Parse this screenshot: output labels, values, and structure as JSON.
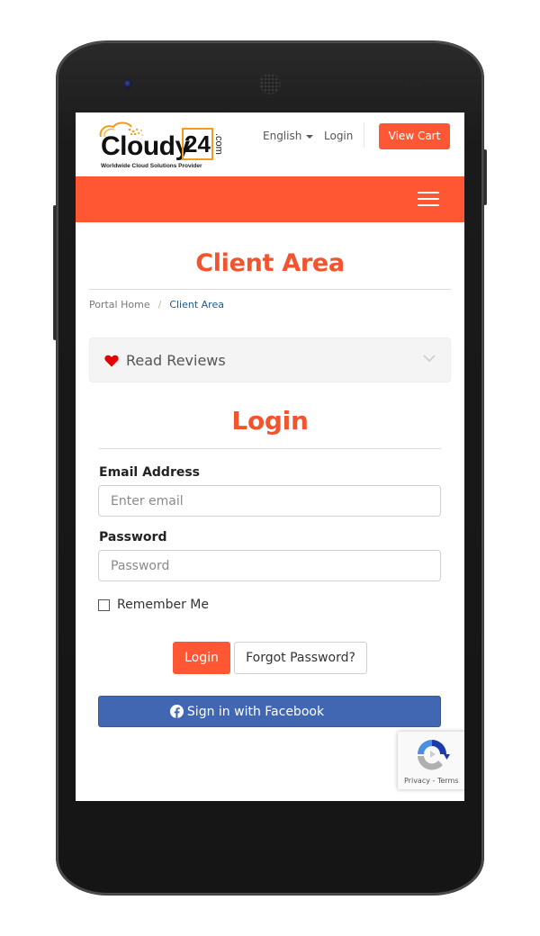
{
  "header": {
    "logo": {
      "brand": "Cloudy",
      "number": "24",
      "tld": ".com",
      "tagline": "Worldwide Cloud Solutions Provider"
    },
    "language": "English",
    "login_link": "Login",
    "view_cart_label": "View Cart"
  },
  "page": {
    "title": "Client Area",
    "breadcrumb": [
      {
        "label": "Portal Home"
      },
      {
        "label": "Client Area"
      }
    ],
    "breadcrumb_separator": "/"
  },
  "reviews": {
    "label": "Read Reviews"
  },
  "login_form": {
    "title": "Login",
    "email_label": "Email Address",
    "email_placeholder": "Enter email",
    "email_value": "",
    "password_label": "Password",
    "password_placeholder": "Password",
    "password_value": "",
    "remember_label": "Remember Me",
    "remember_checked": false,
    "login_button": "Login",
    "forgot_button": "Forgot Password?",
    "facebook_button": "Sign in with Facebook"
  },
  "recaptcha": {
    "links": "Privacy - Terms"
  },
  "colors": {
    "accent": "#ff5733",
    "title": "#f25430",
    "facebook": "#4267b2",
    "breadcrumb_active": "#1e5a8c",
    "heart": "#e60000"
  }
}
